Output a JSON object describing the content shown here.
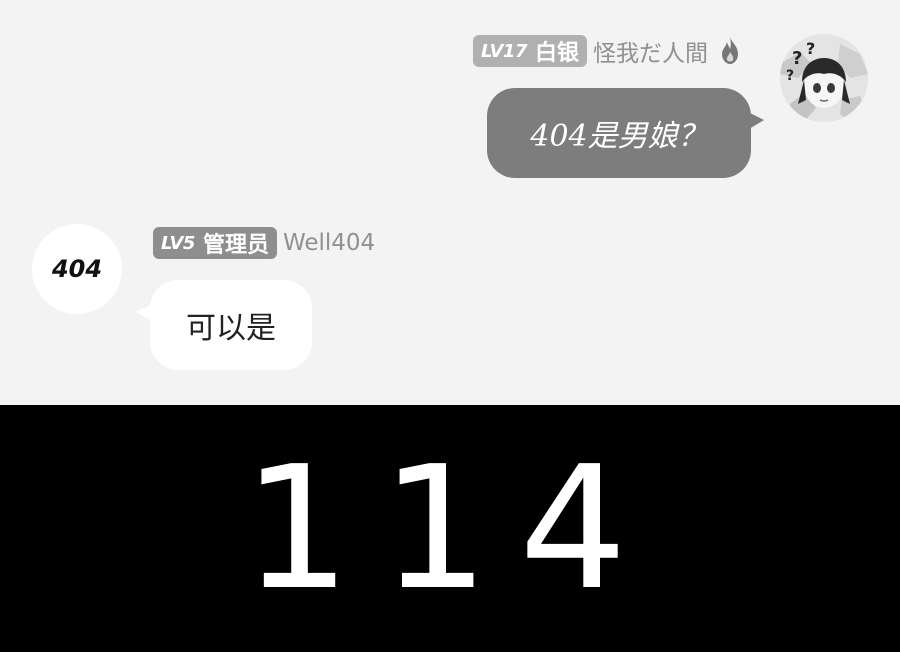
{
  "messages": {
    "outgoing": {
      "level": "LV17",
      "role": "白银",
      "username": "怪我だ人間",
      "text": "404是男娘？",
      "avatar": "anime-girl-avatar",
      "name_icon": "flame-icon"
    },
    "incoming": {
      "level": "LV5",
      "role": "管理员",
      "username": "Well404",
      "text": "可以是",
      "avatar_text": "404"
    }
  },
  "caption": {
    "text": "114"
  },
  "colors": {
    "background": "#f3f3f3",
    "outgoing_bubble": "#7d7d7d",
    "incoming_bubble": "#ffffff",
    "badge": "#b0b0b0",
    "caption_background": "#000000",
    "caption_text": "#ffffff"
  }
}
